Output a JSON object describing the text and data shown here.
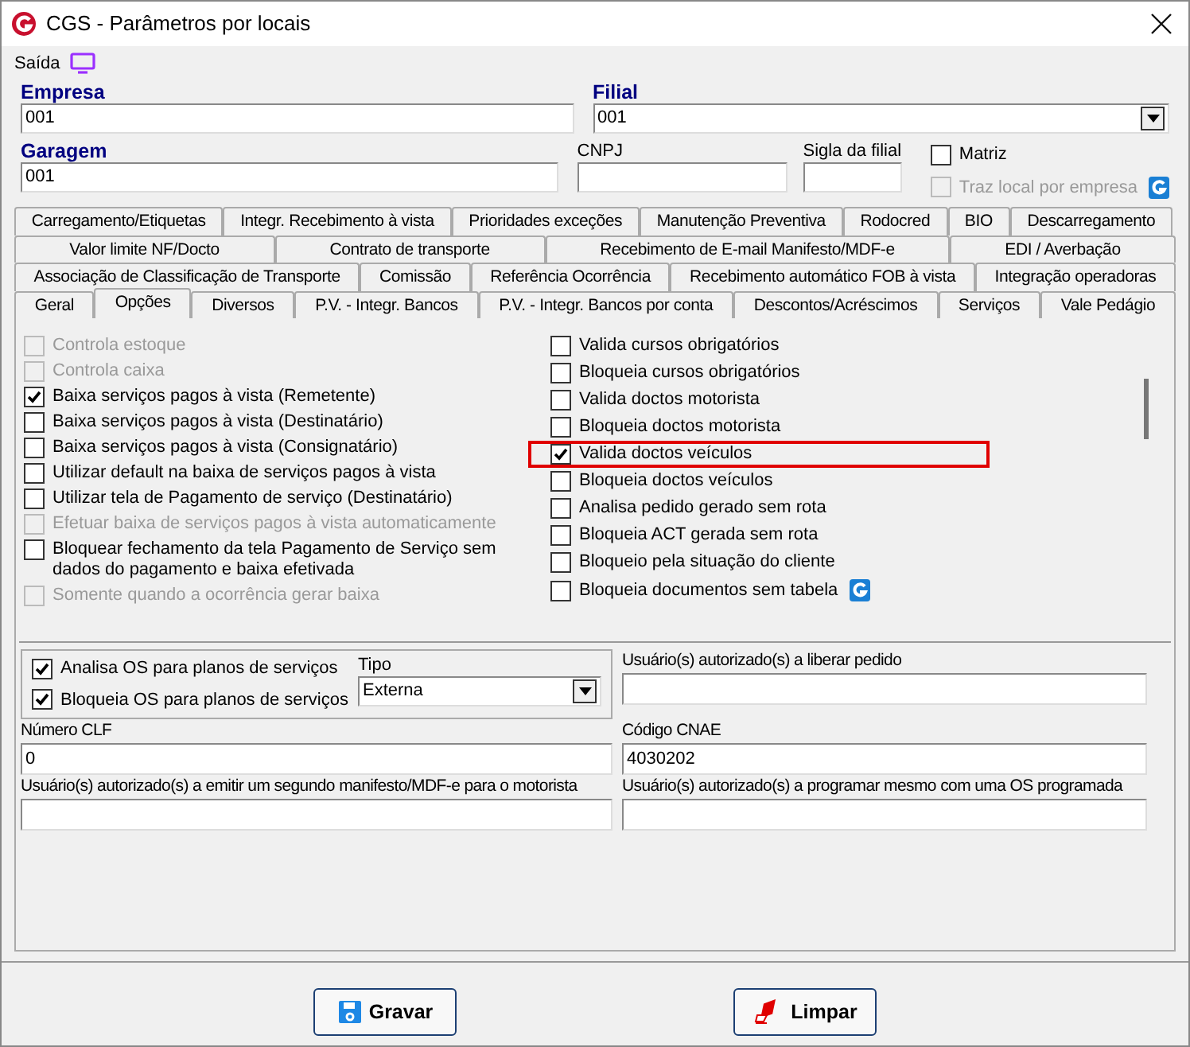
{
  "window": {
    "title": "CGS - Parâmetros por locais"
  },
  "menu": {
    "label": "Saída"
  },
  "header": {
    "empresa": {
      "label": "Empresa",
      "value": "001"
    },
    "filial": {
      "label": "Filial",
      "value": "001"
    },
    "garagem": {
      "label": "Garagem",
      "value": "001"
    },
    "cnpj": {
      "label": "CNPJ"
    },
    "sigla": {
      "label": "Sigla da filial"
    },
    "matriz": {
      "label": "Matriz",
      "checked": false,
      "disabled": false
    },
    "traz_local": {
      "label": "Traz local por empresa",
      "checked": false,
      "disabled": true
    }
  },
  "tab_rows": [
    [
      {
        "label": "Carregamento/Etiquetas",
        "selected": false
      },
      {
        "label": "Integr. Recebimento à vista",
        "selected": false
      },
      {
        "label": "Prioridades exceções",
        "selected": false
      },
      {
        "label": "Manutenção Preventiva",
        "selected": false
      },
      {
        "label": "Rodocred",
        "selected": false
      },
      {
        "label": "BIO",
        "selected": false
      },
      {
        "label": "Descarregamento",
        "selected": false
      }
    ],
    [
      {
        "label": "Valor limite NF/Docto",
        "selected": false
      },
      {
        "label": "Contrato de transporte",
        "selected": false
      },
      {
        "label": "Recebimento de E-mail Manifesto/MDF-e",
        "selected": false
      },
      {
        "label": "EDI / Averbação",
        "selected": false
      }
    ],
    [
      {
        "label": "Associação de Classificação de Transporte",
        "selected": false
      },
      {
        "label": "Comissão",
        "selected": false
      },
      {
        "label": "Referência Ocorrência",
        "selected": false
      },
      {
        "label": "Recebimento automático FOB à vista",
        "selected": false
      },
      {
        "label": "Integração operadoras",
        "selected": false
      }
    ],
    [
      {
        "label": "Geral",
        "selected": false
      },
      {
        "label": "Opções",
        "selected": true
      },
      {
        "label": "Diversos",
        "selected": false
      },
      {
        "label": "P.V. - Integr. Bancos",
        "selected": false
      },
      {
        "label": "P.V. - Integr. Bancos por conta",
        "selected": false
      },
      {
        "label": "Descontos/Acréscimos",
        "selected": false
      },
      {
        "label": "Serviços",
        "selected": false
      },
      {
        "label": "Vale Pedágio",
        "selected": false
      }
    ]
  ],
  "left_options": [
    {
      "label": "Controla estoque",
      "checked": false,
      "disabled": true
    },
    {
      "label": "Controla caixa",
      "checked": false,
      "disabled": true
    },
    {
      "label": "Baixa serviços pagos à vista (Remetente)",
      "checked": true,
      "disabled": false
    },
    {
      "label": "Baixa serviços pagos à vista (Destinatário)",
      "checked": false,
      "disabled": false
    },
    {
      "label": "Baixa serviços pagos à vista (Consignatário)",
      "checked": false,
      "disabled": false
    },
    {
      "label": "Utilizar default na baixa de serviços pagos à vista",
      "checked": false,
      "disabled": false
    },
    {
      "label": "Utilizar tela de Pagamento de serviço (Destinatário)",
      "checked": false,
      "disabled": false
    },
    {
      "label": "Efetuar baixa de serviços pagos à vista automaticamente",
      "checked": false,
      "disabled": true
    },
    {
      "label": "Bloquear fechamento da tela Pagamento de Serviço sem dados do pagamento e baixa efetivada",
      "checked": false,
      "disabled": false
    },
    {
      "label": "Somente quando a ocorrência gerar baixa",
      "checked": false,
      "disabled": true
    }
  ],
  "right_options": [
    {
      "label": "Valida cursos obrigatórios",
      "checked": false,
      "highlighted": false,
      "badge": false
    },
    {
      "label": "Bloqueia cursos obrigatórios",
      "checked": false,
      "highlighted": false,
      "badge": false
    },
    {
      "label": "Valida doctos motorista",
      "checked": false,
      "highlighted": false,
      "badge": false
    },
    {
      "label": "Bloqueia doctos motorista",
      "checked": false,
      "highlighted": false,
      "badge": false
    },
    {
      "label": "Valida doctos veículos",
      "checked": true,
      "highlighted": true,
      "badge": false
    },
    {
      "label": "Bloqueia doctos veículos",
      "checked": false,
      "highlighted": false,
      "badge": false
    },
    {
      "label": "Analisa pedido gerado sem rota",
      "checked": false,
      "highlighted": false,
      "badge": false
    },
    {
      "label": "Bloqueia ACT gerada sem rota",
      "checked": false,
      "highlighted": false,
      "badge": false
    },
    {
      "label": "Bloqueio pela situação do cliente",
      "checked": false,
      "highlighted": false,
      "badge": false
    },
    {
      "label": "Bloqueia documentos sem tabela",
      "checked": false,
      "highlighted": false,
      "badge": true
    }
  ],
  "os_group": {
    "options": [
      {
        "label": "Analisa OS para planos de serviços",
        "checked": true
      },
      {
        "label": "Bloqueia OS para planos de serviços",
        "checked": true
      }
    ],
    "tipo": {
      "label": "Tipo",
      "value": "Externa"
    }
  },
  "fields": [
    {
      "label": "Usuário(s) autorizado(s) a liberar pedido"
    },
    {
      "label": "Número CLF",
      "value": "0"
    },
    {
      "label": "Código CNAE",
      "value": "4030202"
    },
    {
      "label": "Usuário(s) autorizado(s) a emitir um segundo manifesto/MDF-e para o motorista"
    },
    {
      "label": "Usuário(s) autorizado(s) a programar mesmo com uma OS programada"
    }
  ],
  "buttons": [
    {
      "label": "Gravar",
      "kind": "save"
    },
    {
      "label": "Limpar",
      "kind": "clear"
    }
  ]
}
